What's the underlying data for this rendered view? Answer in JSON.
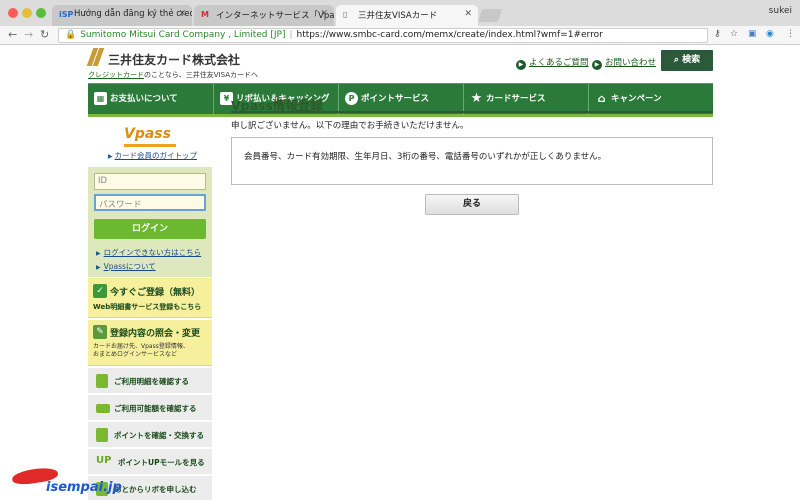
{
  "browser": {
    "user": "sukei",
    "tabs": [
      {
        "favicon": "iSP",
        "label": "Hướng dẫn đăng ký thẻ credit"
      },
      {
        "favicon": "M",
        "label": "インターネットサービス「Vpass」"
      },
      {
        "favicon": "doc",
        "label": "三井住友VISAカード"
      }
    ],
    "cert_owner": "Sumitomo Mitsui Card Company , Limited [JP]",
    "url": "https://www.smbc-card.com/memx/create/index.html?wmf=1#error"
  },
  "header": {
    "company": "三井住友カード株式会社",
    "subtag_link": "クレジットカード",
    "subtag_rest": "のことなら、三井住友VISAカードへ",
    "faq": "よくあるご質問",
    "contact": "お問い合わせ",
    "search": "検索"
  },
  "gnav": [
    "お支払いについて",
    "リボ払い＆キャッシング",
    "ポイントサービス",
    "カードサービス",
    "キャンペーン"
  ],
  "sidebar": {
    "vpass_logo": "Vpass",
    "gatop": "カード会員のガイトップ",
    "id_placeholder": "ID",
    "password_placeholder": "パスワード",
    "login": "ログイン",
    "link_cant_login": "ログインできない方はこちら",
    "link_about": "Vpassについて",
    "register_title": "今すぐご登録（無料）",
    "register_sub": "Web明細書サービス登録もこちら",
    "change_title": "登録内容の照会・変更",
    "change_line1": "カードお届け先、Vpass登録情報、",
    "change_line2": "おまとめログインサービスなど",
    "menu": [
      "ご利用明細を確認する",
      "ご利用可能額を確認する",
      "ポイントを確認・交換する",
      "ポイントUPモールを見る",
      "あとからリボを申し込む"
    ]
  },
  "main": {
    "title": "Vpass情報登録",
    "lead": "申し訳ございません。以下の理由でお手続きいただけません。",
    "error": "会員番号、カード有効期限、生年月日、3桁の番号、電話番号のいずれかが正しくありません。",
    "back": "戻る"
  },
  "watermark": "isempai.jp",
  "colors": {
    "brand_green": "#2c7a3a",
    "accent_lime": "#6cb82e",
    "promo_yellow": "#f6ef9c"
  }
}
